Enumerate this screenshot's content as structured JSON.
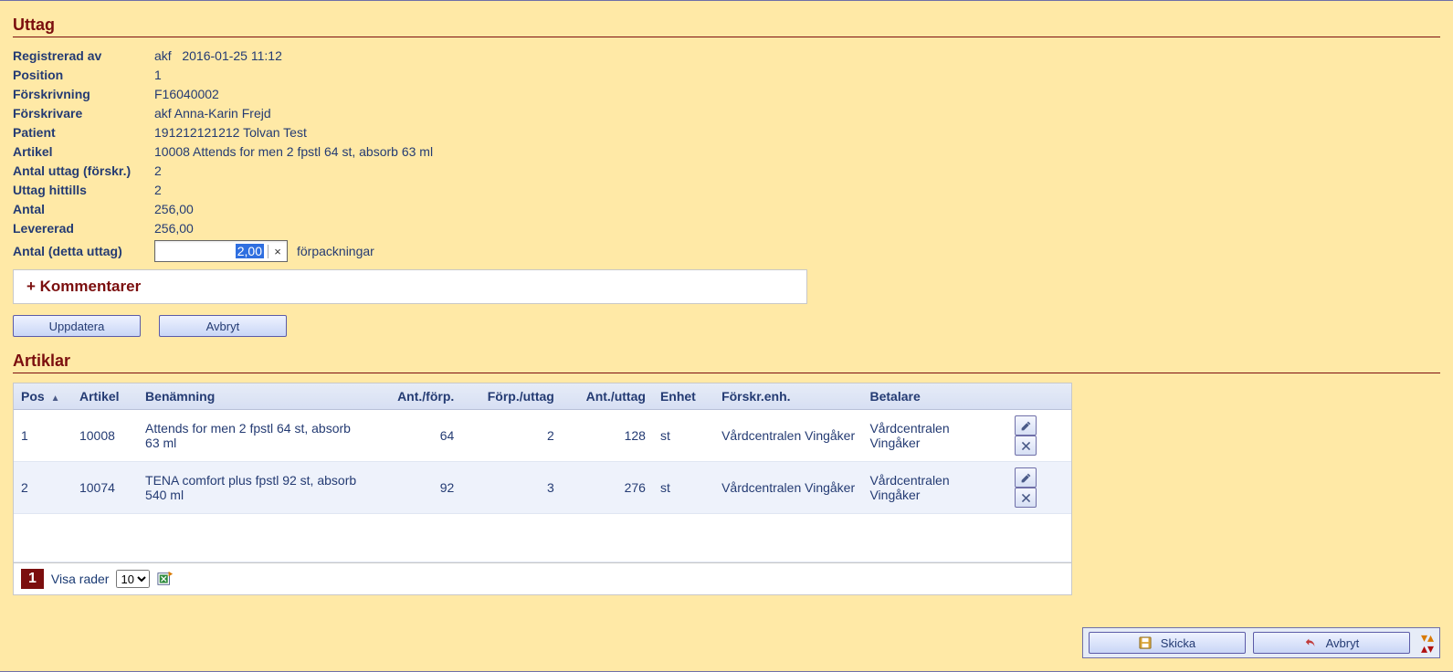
{
  "sections": {
    "uttag_title": "Uttag",
    "artiklar_title": "Artiklar"
  },
  "fields": {
    "registrerad_av": {
      "label": "Registrerad av",
      "user": "akf",
      "ts": "2016-01-25 11:12"
    },
    "position": {
      "label": "Position",
      "value": "1"
    },
    "forskrivning": {
      "label": "Förskrivning",
      "value": "F16040002"
    },
    "forskrivare": {
      "label": "Förskrivare",
      "value": "akf Anna-Karin Frejd"
    },
    "patient": {
      "label": "Patient",
      "value": "191212121212 Tolvan Test"
    },
    "artikel": {
      "label": "Artikel",
      "value": "10008 Attends for men 2 fpstl 64 st, absorb 63 ml"
    },
    "antal_uttag": {
      "label": "Antal uttag (förskr.)",
      "value": "2"
    },
    "uttag_hittills": {
      "label": "Uttag hittills",
      "value": "2"
    },
    "antal": {
      "label": "Antal",
      "value": "256,00"
    },
    "levererad": {
      "label": "Levererad",
      "value": "256,00"
    },
    "antal_detta": {
      "label": "Antal (detta uttag)",
      "value": "2,00",
      "unit": "förpackningar"
    }
  },
  "kommentarer": {
    "label": "+ Kommentarer"
  },
  "buttons": {
    "uppdatera": "Uppdatera",
    "avbryt": "Avbryt",
    "skicka": "Skicka",
    "avbryt2": "Avbryt"
  },
  "pager": {
    "page": "1",
    "visa_label": "Visa rader",
    "visa_value": "10"
  },
  "table": {
    "headers": {
      "pos": "Pos",
      "artikel": "Artikel",
      "benamning": "Benämning",
      "ant_forp": "Ant./förp.",
      "forp_uttag": "Förp./uttag",
      "ant_uttag": "Ant./uttag",
      "enhet": "Enhet",
      "forskr_enh": "Förskr.enh.",
      "betalare": "Betalare"
    },
    "rows": [
      {
        "pos": "1",
        "artikel": "10008",
        "benamning": "Attends for men 2 fpstl 64 st, absorb 63 ml",
        "ant_forp": "64",
        "forp_uttag": "2",
        "ant_uttag": "128",
        "enhet": "st",
        "forskr_enh": "Vårdcentralen Vingåker",
        "betalare": "Vårdcentralen Vingåker"
      },
      {
        "pos": "2",
        "artikel": "10074",
        "benamning": "TENA comfort plus fpstl 92 st, absorb 540 ml",
        "ant_forp": "92",
        "forp_uttag": "3",
        "ant_uttag": "276",
        "enhet": "st",
        "forskr_enh": "Vårdcentralen Vingåker",
        "betalare": "Vårdcentralen Vingåker"
      }
    ]
  }
}
